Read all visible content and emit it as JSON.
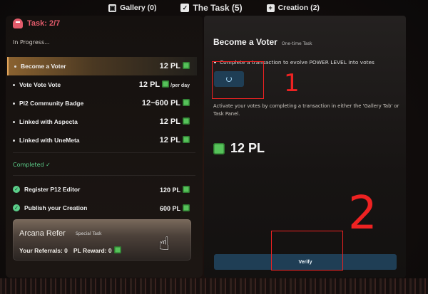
{
  "top_tabs": [
    {
      "label": "Gallery (0)",
      "icon": "image-icon"
    },
    {
      "label": "The Task (5)",
      "icon": "checkbox-icon"
    },
    {
      "label": "Creation (2)",
      "icon": "plus-square-icon"
    }
  ],
  "left": {
    "task_count": "Task: 2/7",
    "in_progress_label": "In Progress...",
    "in_progress": [
      {
        "label": "Become a Voter",
        "value": "12 PL"
      },
      {
        "label": "Vote Vote Vote",
        "value": "12 PL",
        "suffix": "/per day"
      },
      {
        "label": "Pl2 Community Badge",
        "value": "12~600 PL"
      },
      {
        "label": "Linked with Aspecta",
        "value": "12 PL"
      },
      {
        "label": "Linked with UneMeta",
        "value": "12 PL"
      }
    ],
    "completed_label": "Completed ✓",
    "completed": [
      {
        "label": "Register P12 Editor",
        "value": "120 PL"
      },
      {
        "label": "Publish your Creation",
        "value": "600 PL"
      }
    ],
    "refer": {
      "title": "Arcana Refer",
      "tag": "Special Task",
      "referrals": "Your Referrals: 0",
      "reward": "PL Reward: 0"
    }
  },
  "right": {
    "title": "Become a Voter",
    "tag": "One-time Task",
    "requirement": "Complete a transaction to evolve POWER LEVEL into votes",
    "instruction": "Activate your votes by completing a transaction in either the 'Gallery Tab' or Task Panel.",
    "reward": "12 PL",
    "verify_label": "Verify"
  },
  "annotations": {
    "one": "1",
    "two": "2"
  },
  "colors": {
    "accent_red": "#e35b6b",
    "green": "#5ccf8a",
    "button_blue": "#1f3e55",
    "annotation_red": "#e22222"
  }
}
